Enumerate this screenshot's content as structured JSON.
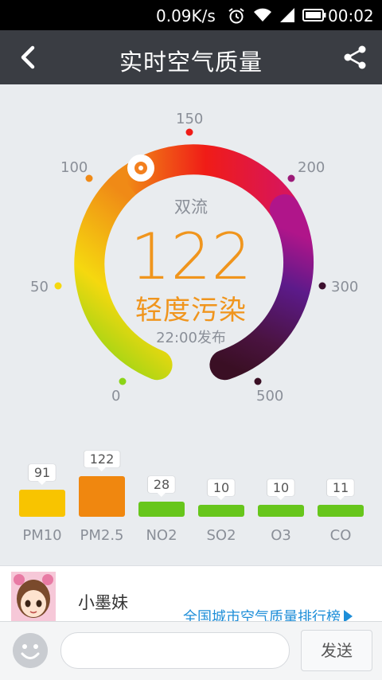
{
  "status_bar": {
    "net_speed": "0.09K/s",
    "time": "00:02",
    "icons": [
      "alarm-icon",
      "wifi-icon",
      "signal-icon",
      "battery-icon"
    ]
  },
  "header": {
    "title": "实时空气质量",
    "back_icon": "chevron-left-icon",
    "share_icon": "share-icon"
  },
  "gauge": {
    "city": "双流",
    "aqi": "122",
    "level": "轻度污染",
    "published": "22:00发布",
    "scale_labels": [
      "0",
      "50",
      "100",
      "150",
      "200",
      "300",
      "500"
    ],
    "indicator_value": 122,
    "colors": {
      "aqi_text": "#f0951d",
      "good": "#8bd417",
      "moderate": "#f5d80f",
      "unhealthy_sensitive": "#f08a16",
      "unhealthy": "#f01c17",
      "very_unhealthy": "#5c1a8a",
      "hazardous": "#3a0f24"
    }
  },
  "pollutants": [
    {
      "name": "PM10",
      "value": "91",
      "color": "#f8c400"
    },
    {
      "name": "PM2.5",
      "value": "122",
      "color": "#f0870f"
    },
    {
      "name": "NO2",
      "value": "28",
      "color": "#67c61c"
    },
    {
      "name": "SO2",
      "value": "10",
      "color": "#67c61c"
    },
    {
      "name": "O3",
      "value": "10",
      "color": "#67c61c"
    },
    {
      "name": "CO",
      "value": "11",
      "color": "#67c61c"
    }
  ],
  "profile": {
    "username": "小墨妹",
    "rank_link": "全国城市空气质量排行榜"
  },
  "composer": {
    "placeholder": "",
    "send_label": "发送",
    "emoji_icon": "smiley-icon"
  }
}
